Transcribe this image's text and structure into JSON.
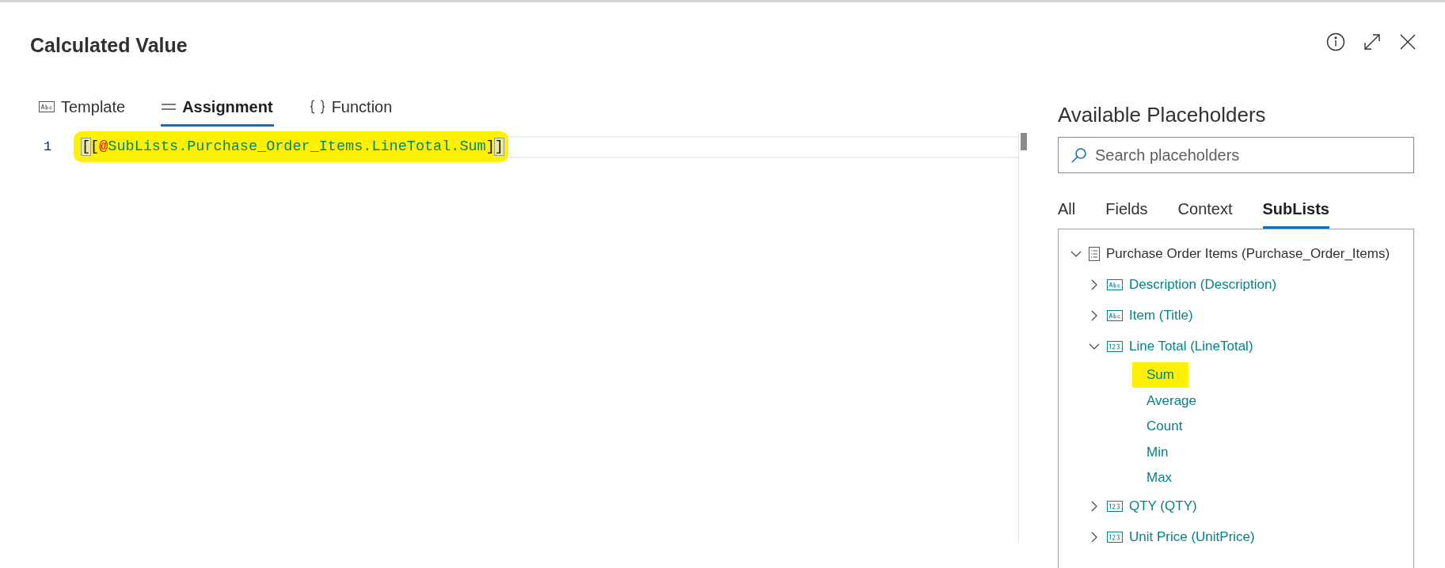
{
  "dialog": {
    "title": "Calculated Value"
  },
  "editor_tabs": [
    {
      "label": "Template",
      "kind": "template",
      "selected": false
    },
    {
      "label": "Assignment",
      "kind": "assignment",
      "selected": true
    },
    {
      "label": "Function",
      "kind": "function",
      "selected": false
    }
  ],
  "editor": {
    "lines": [
      {
        "number": "1",
        "highlighted": true,
        "tokens": [
          {
            "text": "[",
            "kind": "bracket",
            "matched": true
          },
          {
            "text": "[",
            "kind": "bracket",
            "matched": false
          },
          {
            "text": "@",
            "kind": "at",
            "matched": false
          },
          {
            "text": "SubLists.Purchase_Order_Items.LineTotal.Sum",
            "kind": "name",
            "matched": false
          },
          {
            "text": "]",
            "kind": "bracket",
            "matched": false
          },
          {
            "text": "]",
            "kind": "bracket",
            "matched": true
          }
        ]
      }
    ]
  },
  "placeholders": {
    "title": "Available Placeholders",
    "search": {
      "placeholder": "Search placeholders"
    },
    "tabs": [
      {
        "label": "All",
        "selected": false
      },
      {
        "label": "Fields",
        "selected": false
      },
      {
        "label": "Context",
        "selected": false
      },
      {
        "label": "SubLists",
        "selected": true
      }
    ],
    "tree": [
      {
        "label": "Purchase Order Items (Purchase_Order_Items)",
        "kind": "list",
        "expanded": true,
        "children": [
          {
            "label": "Description (Description)",
            "kind": "text",
            "expanded": false
          },
          {
            "label": "Item (Title)",
            "kind": "text",
            "expanded": false
          },
          {
            "label": "Line Total (LineTotal)",
            "kind": "number",
            "expanded": true,
            "children": [
              {
                "label": "Sum",
                "kind": "aggregate",
                "highlighted": true
              },
              {
                "label": "Average",
                "kind": "aggregate",
                "highlighted": false
              },
              {
                "label": "Count",
                "kind": "aggregate",
                "highlighted": false
              },
              {
                "label": "Min",
                "kind": "aggregate",
                "highlighted": false
              },
              {
                "label": "Max",
                "kind": "aggregate",
                "highlighted": false
              }
            ]
          },
          {
            "label": "QTY (QTY)",
            "kind": "number",
            "expanded": false
          },
          {
            "label": "Unit Price (UnitPrice)",
            "kind": "number",
            "expanded": false
          }
        ]
      }
    ]
  }
}
